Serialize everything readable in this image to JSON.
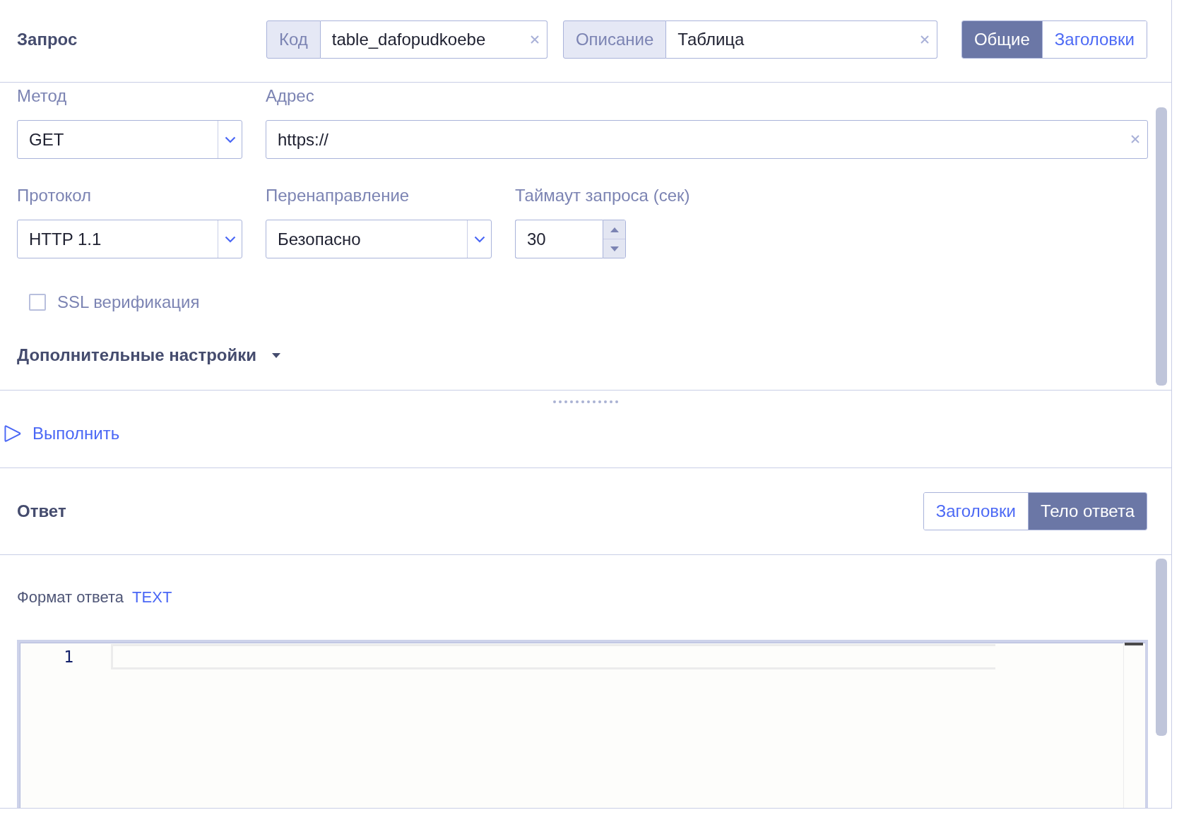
{
  "request": {
    "title": "Запрос",
    "code": {
      "label": "Код",
      "value": "table_dafopudkoebe"
    },
    "description": {
      "label": "Описание",
      "value": "Таблица"
    },
    "tabs": [
      {
        "label": "Общие",
        "selected": true
      },
      {
        "label": "Заголовки",
        "selected": false
      }
    ],
    "method": {
      "label": "Метод",
      "value": "GET"
    },
    "address": {
      "label": "Адрес",
      "value": "https://"
    },
    "protocol": {
      "label": "Протокол",
      "value": "HTTP 1.1"
    },
    "redirect": {
      "label": "Перенаправление",
      "value": "Безопасно"
    },
    "timeout": {
      "label": "Таймаут запроса (сек)",
      "value": "30"
    },
    "ssl_verification": {
      "label": "SSL верификация",
      "checked": false
    },
    "advanced_settings": {
      "label": "Дополнительные настройки",
      "expanded": false
    }
  },
  "run_button": {
    "label": "Выполнить"
  },
  "response": {
    "title": "Ответ",
    "tabs": [
      {
        "label": "Заголовки",
        "selected": false
      },
      {
        "label": "Тело ответа",
        "selected": true
      }
    ],
    "format": {
      "label": "Формат ответа",
      "value": "TEXT"
    },
    "editor": {
      "line_numbers": [
        "1"
      ]
    }
  }
}
